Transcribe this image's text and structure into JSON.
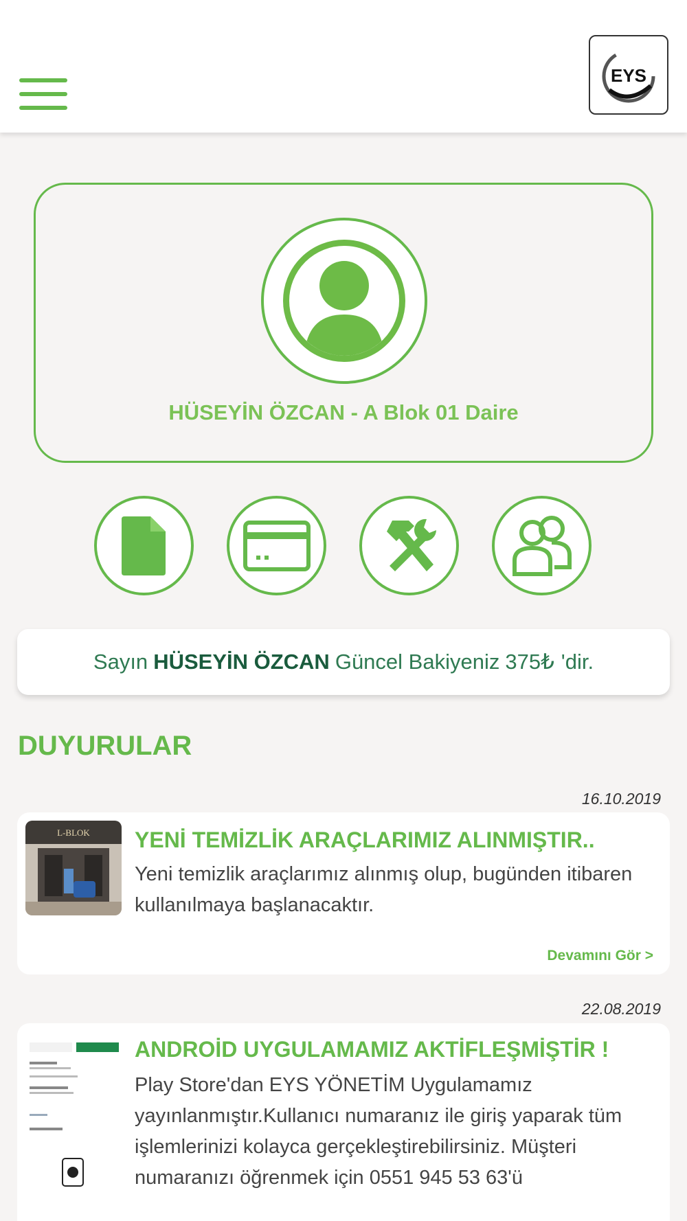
{
  "header": {
    "menu_icon": "hamburger-menu-icon",
    "logo_text": "EYS",
    "accent_color": "#65b94b"
  },
  "profile": {
    "avatar_icon": "user-avatar-icon",
    "name_line": "HÜSEYİN ÖZCAN - A Blok 01 Daire"
  },
  "actions": [
    {
      "icon": "document-icon"
    },
    {
      "icon": "credit-card-icon"
    },
    {
      "icon": "tools-icon"
    },
    {
      "icon": "users-icon"
    }
  ],
  "balance": {
    "prefix": "Sayın",
    "name": "HÜSEYİN ÖZCAN",
    "middle": "Güncel Bakiyeniz",
    "amount": "375₺",
    "suffix": "'dir."
  },
  "announcements": {
    "title": "DUYURULAR",
    "items": [
      {
        "date": "16.10.2019",
        "title": "YENİ TEMİZLİK ARAÇLARIMIZ ALINMIŞTIR..",
        "body": "Yeni temizlik araçlarımız alınmış olup, bugünden itibaren kullanılmaya başlanacaktır.",
        "more": "Devamını Gör >",
        "thumb_sign": "L-BLOK"
      },
      {
        "date": "22.08.2019",
        "title": "ANDROİD UYGULAMAMIZ AKTİFLEŞMİŞTİR !",
        "body": "Play Store'dan EYS YÖNETİM Uygulamamız yayınlanmıştır.Kullanıcı numaranız ile giriş yaparak tüm işlemlerinizi kolayca gerçekleştirebilirsiniz. Müşteri numaranızı öğrenmek için 0551 945 53 63'ü"
      }
    ]
  }
}
